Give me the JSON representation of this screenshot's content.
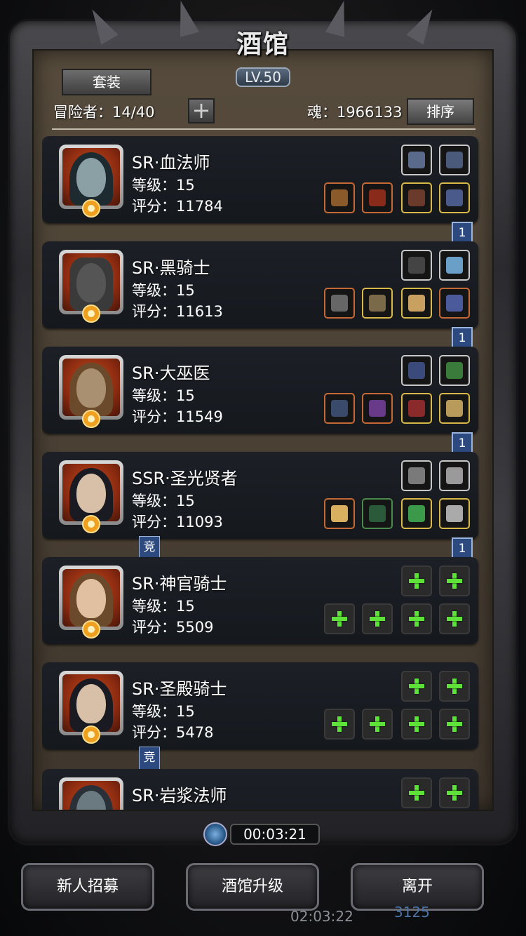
{
  "header": {
    "title": "酒馆",
    "level": "LV.50",
    "set_button": "套装",
    "adventurers": "冒险者：14/40",
    "add_symbol": "+",
    "soul": "魂：1966133",
    "sort_button": "排序"
  },
  "heroes": [
    {
      "name": "SR·血法师",
      "level": "等级：15",
      "score": "评分：11784",
      "ribbon": "1",
      "jing": ""
    },
    {
      "name": "SR·黑骑士",
      "level": "等级：15",
      "score": "评分：11613",
      "ribbon": "1",
      "jing": ""
    },
    {
      "name": "SR·大巫医",
      "level": "等级：15",
      "score": "评分：11549",
      "ribbon": "1",
      "jing": ""
    },
    {
      "name": "SSR·圣光贤者",
      "level": "等级：15",
      "score": "评分：11093",
      "ribbon": "1",
      "jing": "竞"
    },
    {
      "name": "SR·神官骑士",
      "level": "等级：15",
      "score": "评分：5509",
      "ribbon": "",
      "jing": ""
    },
    {
      "name": "SR·圣殿骑士",
      "level": "等级：15",
      "score": "评分：5478",
      "ribbon": "",
      "jing": "竞"
    },
    {
      "name": "SR·岩浆法师",
      "level": "",
      "score": "",
      "ribbon": "",
      "jing": ""
    }
  ],
  "timer": "00:03:21",
  "buttons": {
    "recruit": "新人招募",
    "upgrade": "酒馆升级",
    "leave": "离开"
  },
  "underlay": {
    "time": "02:03:22",
    "number": "3125"
  },
  "colors": {
    "accent_green": "#5ee23a",
    "ribbon_blue": "#2c4a80",
    "gold_border": "#d9b84a"
  }
}
